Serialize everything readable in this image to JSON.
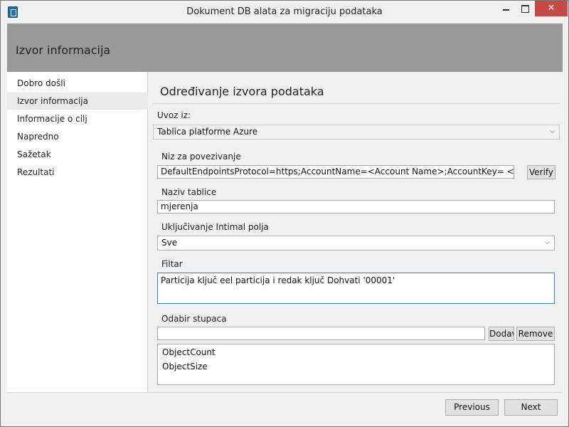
{
  "window": {
    "title": "Dokument DB alata za migraciju podataka",
    "close_glyph": "✕"
  },
  "header": {
    "title": "Izvor informacija"
  },
  "sidebar": {
    "items": [
      {
        "label": "Dobro došli"
      },
      {
        "label": "Izvor informacija"
      },
      {
        "label": "Informacije o cilj"
      },
      {
        "label": "Napredno"
      },
      {
        "label": "Sažetak"
      },
      {
        "label": "Rezultati"
      }
    ]
  },
  "main": {
    "title": "Određivanje izvora podataka",
    "import_from": {
      "label": "Uvoz iz:",
      "value": "Tablica platforme Azure"
    },
    "connection_string": {
      "label": "Niz za povezivanje",
      "value": "DefaultEndpointsProtocol=https;AccountName=<Account Name>;AccountKey= <Account K>’<Account>",
      "verify_label": "Verify"
    },
    "table_name": {
      "label": "Naziv tablice",
      "value": "mjerenja"
    },
    "internal_fields": {
      "label": "Uključivanje Intimal polja",
      "value": "Sve"
    },
    "filter": {
      "label": "Filtar",
      "value": "Particija ključ eel particija i redak ključ Dohvati '00001'"
    },
    "column_selection": {
      "label": "Odabir stupaca",
      "input_value": "",
      "add_label": "Dodavanje",
      "remove_label": "Remove",
      "columns": [
        "ObjectCount",
        "ObjectSize"
      ]
    }
  },
  "footer": {
    "previous_label": "Previous",
    "next_label": "Next"
  },
  "icons": {
    "dropdown": "chevron-down-icon",
    "app": "app-icon"
  }
}
